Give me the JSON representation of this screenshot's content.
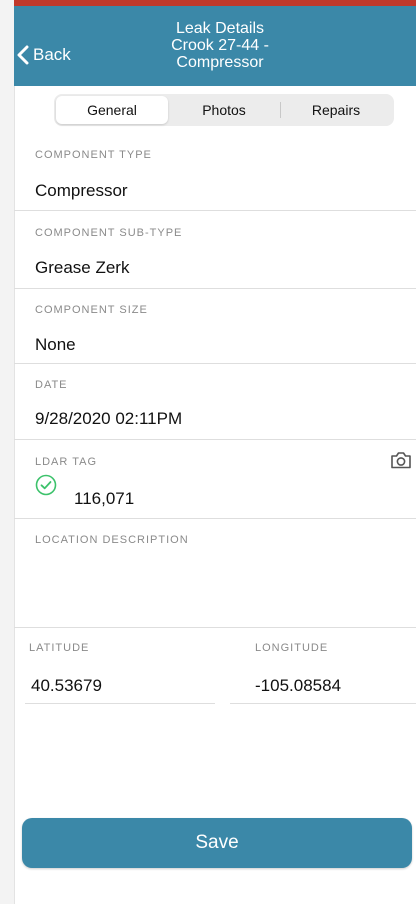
{
  "header": {
    "back_label": "Back",
    "title_line1": "Leak Details",
    "title_line2": "Crook 27-44 -",
    "title_line3": "Compressor"
  },
  "tabs": [
    {
      "label": "General",
      "active": true
    },
    {
      "label": "Photos",
      "active": false
    },
    {
      "label": "Repairs",
      "active": false
    }
  ],
  "fields": {
    "component_type": {
      "label": "COMPONENT TYPE",
      "value": "Compressor"
    },
    "component_sub_type": {
      "label": "COMPONENT SUB-TYPE",
      "value": "Grease Zerk"
    },
    "component_size": {
      "label": "COMPONENT SIZE",
      "value": "None"
    },
    "date": {
      "label": "DATE",
      "value": "9/28/2020 02:11PM"
    },
    "ldar_tag": {
      "label": "LDAR TAG",
      "value": "116,071"
    },
    "location_description": {
      "label": "LOCATION DESCRIPTION",
      "value": ""
    },
    "latitude": {
      "label": "LATITUDE",
      "value": "40.53679"
    },
    "longitude": {
      "label": "LONGITUDE",
      "value": "-105.08584"
    }
  },
  "actions": {
    "save_label": "Save"
  },
  "colors": {
    "header_bg": "#3b88a8",
    "accent_top": "#c0392b",
    "check_green": "#3cc26b",
    "save_bg": "#3b88a8"
  },
  "icons": {
    "back": "chevron-left-icon",
    "camera": "camera-icon",
    "tag_status": "check-circle-icon"
  }
}
